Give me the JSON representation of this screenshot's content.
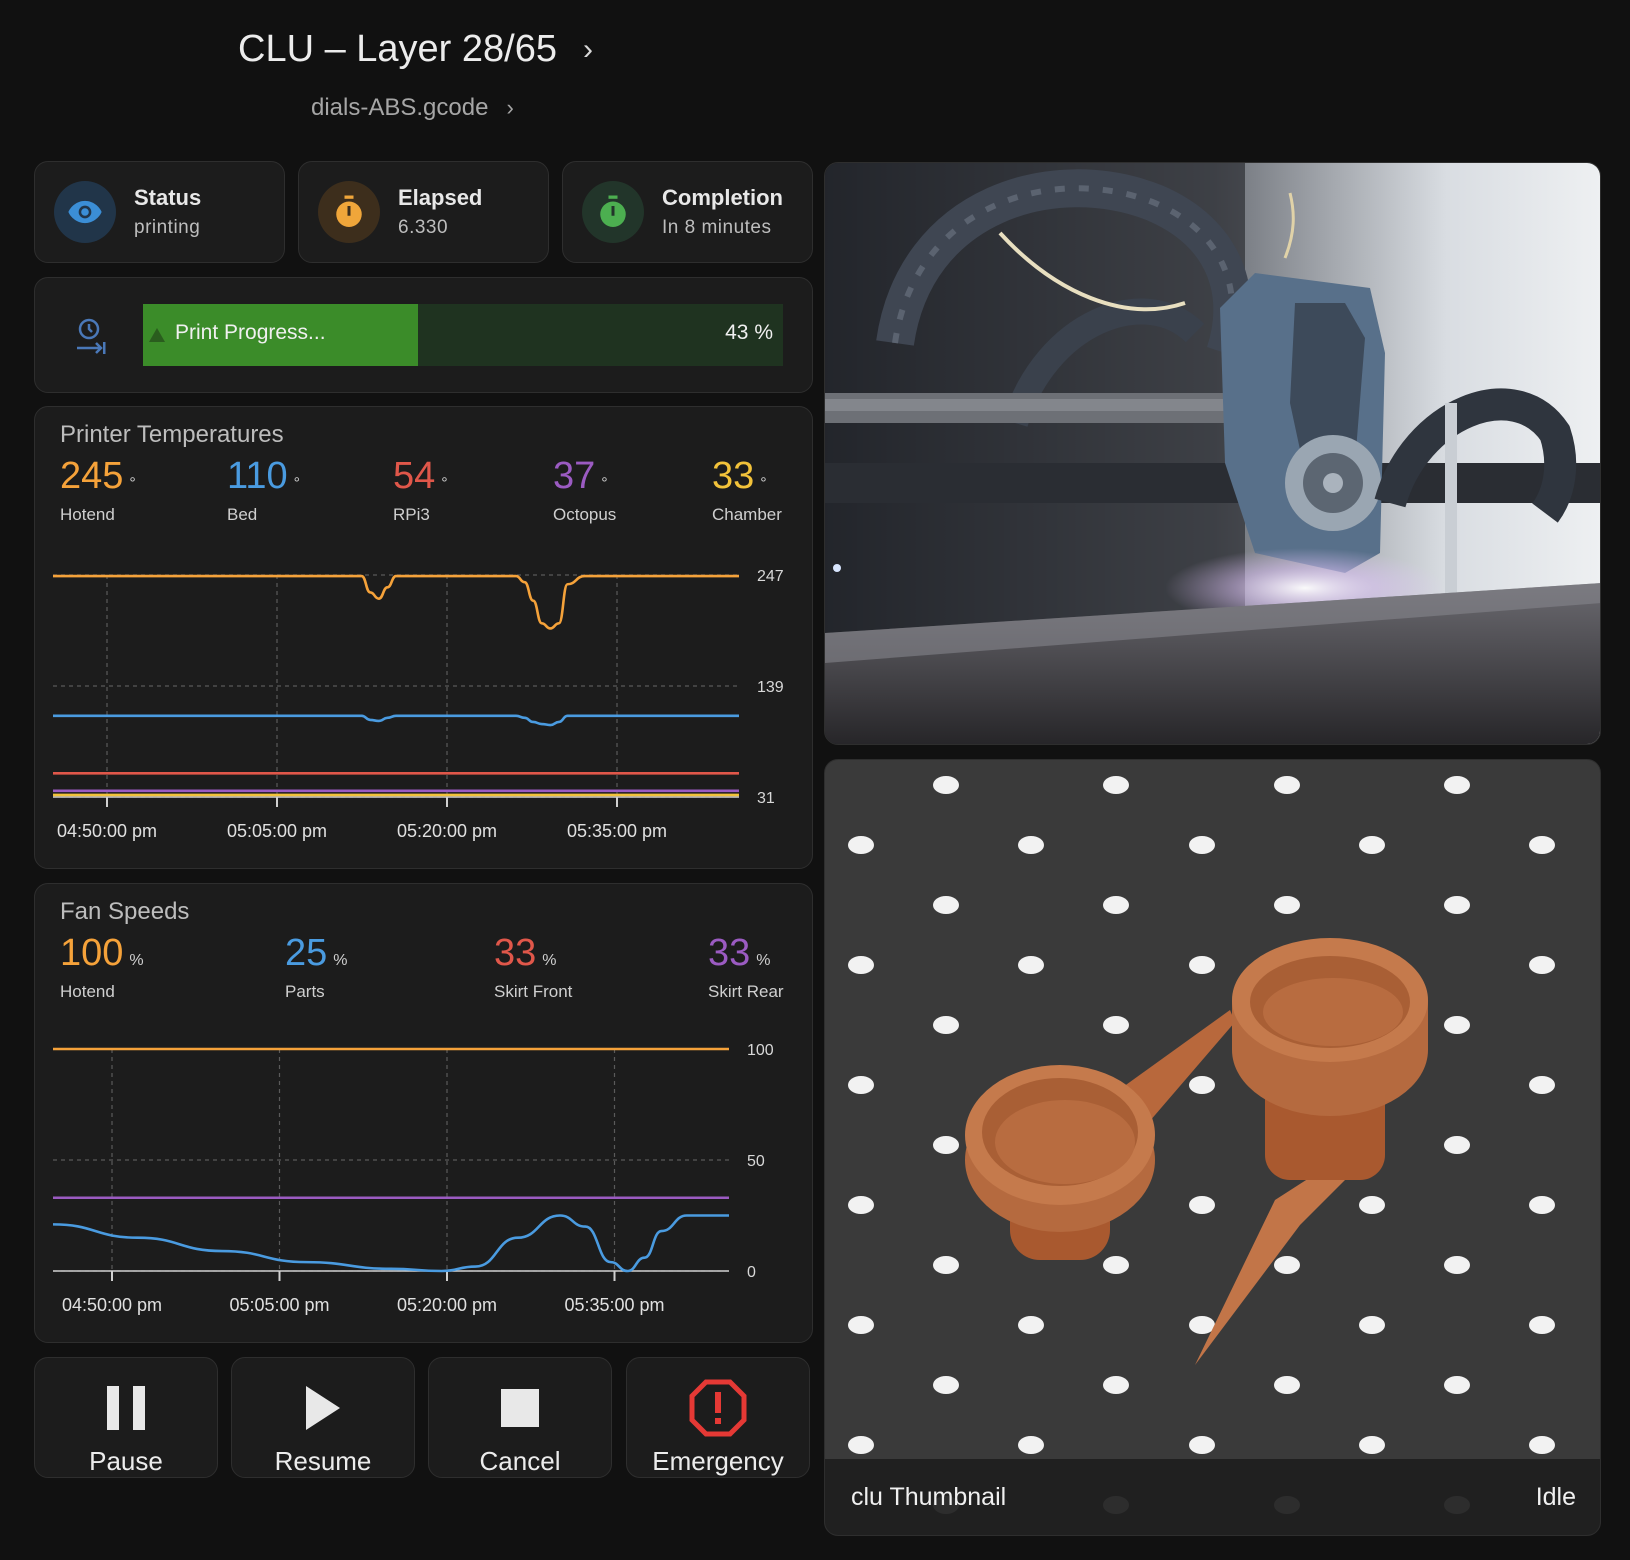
{
  "header": {
    "title": "CLU – Layer 28/65",
    "subtitle": "dials-ABS.gcode"
  },
  "tiles": [
    {
      "label": "Status",
      "value": "printing",
      "icon": "eye-icon",
      "color": "#3b8ed6",
      "bg": "#213549"
    },
    {
      "label": "Elapsed",
      "value": "6.330",
      "icon": "timer-icon",
      "color": "#f0a63a",
      "bg": "#3d2e1c"
    },
    {
      "label": "Completion",
      "value": "In 8 minutes",
      "icon": "timer-icon",
      "color": "#4caf50",
      "bg": "#22352a"
    }
  ],
  "progress": {
    "label": "Print Progress...",
    "value": 43,
    "display": "43 %",
    "icon": "timer-progress-icon"
  },
  "temperatures": {
    "title": "Printer Temperatures",
    "unit": "°",
    "metrics": [
      {
        "value": "245",
        "name": "Hotend",
        "color": "#f5a23a"
      },
      {
        "value": "110",
        "name": "Bed",
        "color": "#4a9be0"
      },
      {
        "value": "54",
        "name": "RPi3",
        "color": "#e0574a"
      },
      {
        "value": "37",
        "name": "Octopus",
        "color": "#9b5bc2"
      },
      {
        "value": "33",
        "name": "Chamber",
        "color": "#f2c23a"
      }
    ],
    "chart_data": {
      "type": "line",
      "ylim": [
        31,
        247
      ],
      "y_ticks": [
        "247",
        "139",
        "31"
      ],
      "x_ticks": [
        "04:50:00 pm",
        "05:05:00 pm",
        "05:20:00 pm",
        "05:35:00 pm"
      ],
      "grid": true,
      "x": [
        0,
        5,
        10,
        15,
        20,
        25,
        30,
        33,
        35,
        36,
        37,
        38,
        39,
        40,
        45,
        50,
        52,
        54,
        55,
        56,
        57,
        58,
        59,
        60,
        62,
        65,
        70,
        75,
        80
      ],
      "series": [
        {
          "color": "#f5a23a",
          "values": [
            246,
            246,
            246,
            246,
            246,
            246,
            246,
            246,
            246,
            246,
            230,
            224,
            235,
            246,
            246,
            246,
            246,
            246,
            240,
            222,
            200,
            195,
            200,
            238,
            246,
            246,
            246,
            246,
            246
          ]
        },
        {
          "color": "#4a9be0",
          "values": [
            110,
            110,
            110,
            110,
            110,
            110,
            110,
            110,
            110,
            110,
            106,
            105,
            108,
            110,
            110,
            110,
            110,
            110,
            108,
            104,
            102,
            101,
            104,
            110,
            110,
            110,
            110,
            110,
            110
          ]
        },
        {
          "color": "#e0574a",
          "values": [
            54,
            54,
            54,
            54,
            54,
            54,
            54,
            54,
            54,
            54,
            54,
            54,
            54,
            54,
            54,
            54,
            54,
            54,
            54,
            54,
            54,
            54,
            54,
            54,
            54,
            54,
            54,
            54,
            54
          ]
        },
        {
          "color": "#9b5bc2",
          "values": [
            37,
            37,
            37,
            37,
            37,
            37,
            37,
            37,
            37,
            37,
            37,
            37,
            37,
            37,
            37,
            37,
            37,
            37,
            37,
            37,
            37,
            37,
            37,
            37,
            37,
            37,
            37,
            37,
            37
          ]
        },
        {
          "color": "#f2c23a",
          "values": [
            33,
            33,
            33,
            33,
            33,
            33,
            33,
            33,
            33,
            33,
            33,
            33,
            33,
            33,
            33,
            33,
            33,
            33,
            33,
            33,
            33,
            33,
            33,
            33,
            33,
            33,
            33,
            33,
            33
          ]
        }
      ]
    }
  },
  "fans": {
    "title": "Fan Speeds",
    "unit": "%",
    "metrics": [
      {
        "value": "100",
        "name": "Hotend",
        "color": "#f5a23a"
      },
      {
        "value": "25",
        "name": "Parts",
        "color": "#4a9be0"
      },
      {
        "value": "33",
        "name": "Skirt Front",
        "color": "#e0574a"
      },
      {
        "value": "33",
        "name": "Skirt Rear",
        "color": "#9b5bc2"
      }
    ],
    "chart_data": {
      "type": "line",
      "ylim": [
        0,
        100
      ],
      "y_ticks": [
        "100",
        "50",
        "0"
      ],
      "x_ticks": [
        "04:50:00 pm",
        "05:05:00 pm",
        "05:20:00 pm",
        "05:35:00 pm"
      ],
      "grid": true,
      "x": [
        0,
        10,
        20,
        30,
        40,
        46,
        50,
        55,
        60,
        63,
        66,
        68,
        70,
        72,
        75,
        80
      ],
      "series": [
        {
          "color": "#f5a23a",
          "values": [
            100,
            100,
            100,
            100,
            100,
            100,
            100,
            100,
            100,
            100,
            100,
            100,
            100,
            100,
            100,
            100
          ]
        },
        {
          "color": "#9b5bc2",
          "values": [
            33,
            33,
            33,
            33,
            33,
            33,
            33,
            33,
            33,
            33,
            33,
            33,
            33,
            33,
            33,
            33
          ]
        },
        {
          "color": "#4a9be0",
          "values": [
            21,
            15,
            9,
            4,
            1,
            0,
            2,
            15,
            25,
            20,
            4,
            0,
            6,
            18,
            25,
            25
          ]
        }
      ]
    }
  },
  "controls": [
    {
      "label": "Pause",
      "icon": "pause-icon"
    },
    {
      "label": "Resume",
      "icon": "play-icon"
    },
    {
      "label": "Cancel",
      "icon": "stop-icon"
    },
    {
      "label": "Emergency",
      "icon": "alert-octagon-icon",
      "color": "#e53935"
    }
  ],
  "camera": {
    "icon": "camera-feed-image"
  },
  "thumbnail": {
    "label": "clu Thumbnail",
    "state": "Idle"
  }
}
